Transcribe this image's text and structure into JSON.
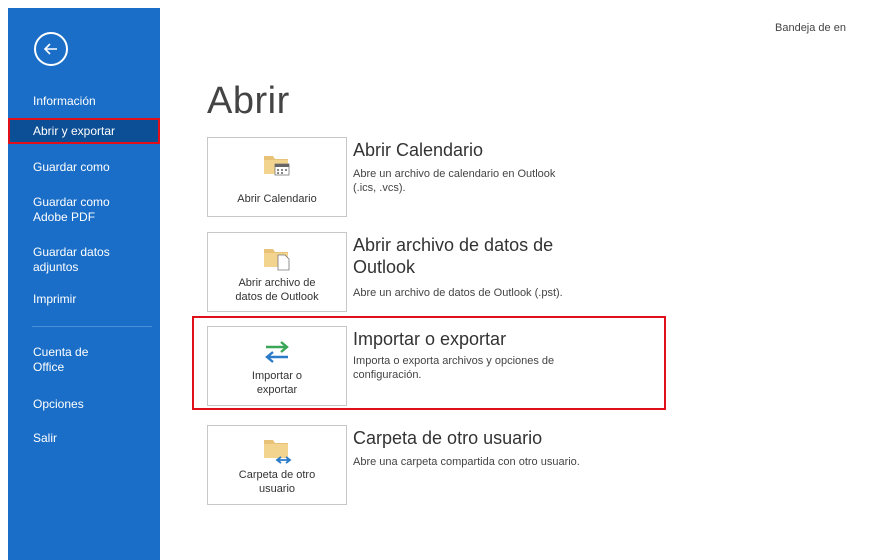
{
  "header": {
    "top_right": "Bandeja de en"
  },
  "sidebar": {
    "back_icon": "back-arrow-icon",
    "items": [
      {
        "label": "Información"
      },
      {
        "label": "Abrir y exportar"
      },
      {
        "label": "Guardar como"
      },
      {
        "label": "Guardar como\nAdobe PDF"
      },
      {
        "label": "Guardar datos\nadjuntos"
      },
      {
        "label": "Imprimir"
      },
      {
        "label": "Cuenta de\nOffice"
      },
      {
        "label": "Opciones"
      },
      {
        "label": "Salir"
      }
    ]
  },
  "main": {
    "title": "Abrir",
    "options": [
      {
        "tile_label": "Abrir Calendario",
        "icon": "folder-calendar-icon",
        "title": "Abrir Calendario",
        "desc": "Abre un archivo de calendario en Outlook\n(.ics, .vcs)."
      },
      {
        "tile_label": "Abrir archivo de\ndatos de Outlook",
        "icon": "folder-file-icon",
        "title": "Abrir archivo de datos de\nOutlook",
        "desc": "Abre un archivo de datos de Outlook (.pst)."
      },
      {
        "tile_label": "Importar o\nexportar",
        "icon": "import-export-arrows-icon",
        "title": "Importar o exportar",
        "desc": "Importa o exporta archivos y opciones de\nconfiguración."
      },
      {
        "tile_label": "Carpeta de otro\nusuario",
        "icon": "shared-folder-icon",
        "title": "Carpeta de otro usuario",
        "desc": "Abre una carpeta compartida con otro usuario."
      }
    ]
  },
  "colors": {
    "sidebar": "#1a6ec7",
    "selected": "#0d4f96",
    "highlight": "#e0101a"
  }
}
